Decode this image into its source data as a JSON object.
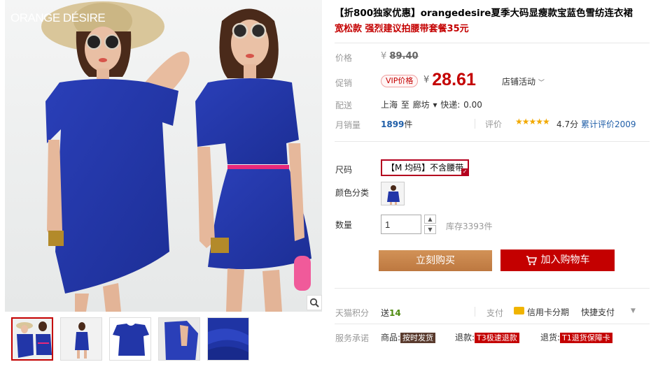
{
  "gallery": {
    "brand_text": "ORANGE DÉSIRE",
    "zoom_icon": "magnifier-icon",
    "thumbnail_count": 5,
    "active_thumbnail": 1
  },
  "product": {
    "title_promo": "【折800独家优惠】",
    "title_main": "orangedesire夏季大码显瘦款宝蓝色雪纺连衣裙",
    "subtitle": "宽松款 强烈建议拍腰带套餐35元"
  },
  "price": {
    "label": "价格",
    "currency": "¥",
    "original": "89.40"
  },
  "promo": {
    "label": "促销",
    "badge": "VIP价格",
    "currency": "¥",
    "current": "28.61",
    "store_activity": "店铺活动",
    "store_activity_icon": "chevron-down-icon"
  },
  "shipping": {
    "label": "配送",
    "text": "上海 至 廊坊 ▾ 快递: 0.00"
  },
  "sales": {
    "label": "月销量",
    "count": "1899",
    "unit": "件",
    "review_label": "评价",
    "stars": "★★★★★",
    "score": "4.7分",
    "cumulative": "累计评价2009"
  },
  "options": {
    "size_label": "尺码",
    "size_value": "【M 均码】不含腰带",
    "color_label": "颜色分类"
  },
  "quantity": {
    "label": "数量",
    "value": "1",
    "up_icon": "arrow-up-icon",
    "down_icon": "arrow-down-icon",
    "stock": "库存3393件"
  },
  "buttons": {
    "buy_now": "立刻购买",
    "add_cart": "加入购物车",
    "cart_icon": "shopping-cart-icon"
  },
  "points": {
    "label": "天猫积分",
    "text_prefix": "送",
    "value": "14",
    "pay_label": "支付",
    "card_icon": "credit-card-icon",
    "card_text": "信用卡分期",
    "quick_pay": "快捷支付"
  },
  "service": {
    "label": "服务承诺",
    "goods_prefix": "商品:",
    "goods_tag": "按时发货",
    "refund_prefix": "退款:",
    "refund_tag": "T3极速退款",
    "return_prefix": "退货:",
    "return_tag": "T1退货保障卡"
  },
  "colors": {
    "accent_red": "#c40000",
    "buy_button": "#c9864b",
    "dress_blue": "#2236a8",
    "link_blue": "#1f5ea8"
  }
}
